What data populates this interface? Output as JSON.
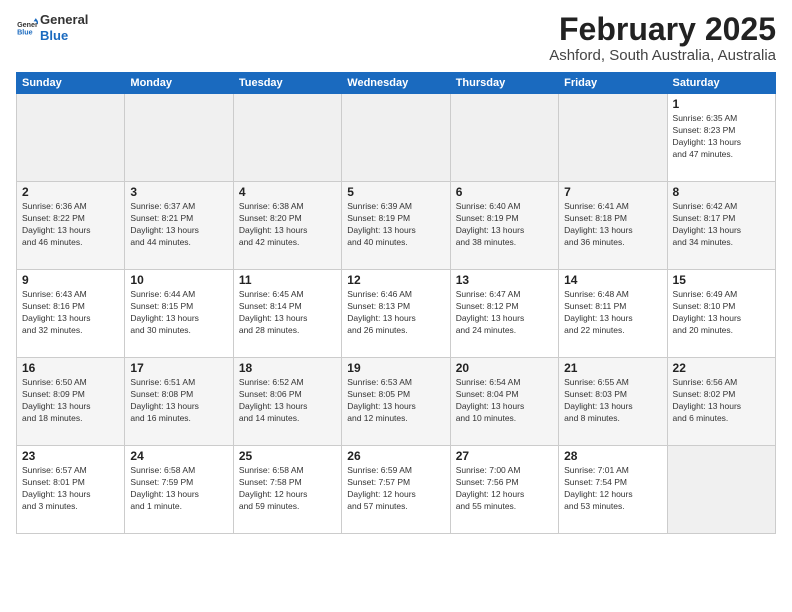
{
  "logo": {
    "line1": "General",
    "line2": "Blue"
  },
  "title": "February 2025",
  "subtitle": "Ashford, South Australia, Australia",
  "headers": [
    "Sunday",
    "Monday",
    "Tuesday",
    "Wednesday",
    "Thursday",
    "Friday",
    "Saturday"
  ],
  "weeks": [
    [
      {
        "day": "",
        "info": ""
      },
      {
        "day": "",
        "info": ""
      },
      {
        "day": "",
        "info": ""
      },
      {
        "day": "",
        "info": ""
      },
      {
        "day": "",
        "info": ""
      },
      {
        "day": "",
        "info": ""
      },
      {
        "day": "1",
        "info": "Sunrise: 6:35 AM\nSunset: 8:23 PM\nDaylight: 13 hours\nand 47 minutes."
      }
    ],
    [
      {
        "day": "2",
        "info": "Sunrise: 6:36 AM\nSunset: 8:22 PM\nDaylight: 13 hours\nand 46 minutes."
      },
      {
        "day": "3",
        "info": "Sunrise: 6:37 AM\nSunset: 8:21 PM\nDaylight: 13 hours\nand 44 minutes."
      },
      {
        "day": "4",
        "info": "Sunrise: 6:38 AM\nSunset: 8:20 PM\nDaylight: 13 hours\nand 42 minutes."
      },
      {
        "day": "5",
        "info": "Sunrise: 6:39 AM\nSunset: 8:19 PM\nDaylight: 13 hours\nand 40 minutes."
      },
      {
        "day": "6",
        "info": "Sunrise: 6:40 AM\nSunset: 8:19 PM\nDaylight: 13 hours\nand 38 minutes."
      },
      {
        "day": "7",
        "info": "Sunrise: 6:41 AM\nSunset: 8:18 PM\nDaylight: 13 hours\nand 36 minutes."
      },
      {
        "day": "8",
        "info": "Sunrise: 6:42 AM\nSunset: 8:17 PM\nDaylight: 13 hours\nand 34 minutes."
      }
    ],
    [
      {
        "day": "9",
        "info": "Sunrise: 6:43 AM\nSunset: 8:16 PM\nDaylight: 13 hours\nand 32 minutes."
      },
      {
        "day": "10",
        "info": "Sunrise: 6:44 AM\nSunset: 8:15 PM\nDaylight: 13 hours\nand 30 minutes."
      },
      {
        "day": "11",
        "info": "Sunrise: 6:45 AM\nSunset: 8:14 PM\nDaylight: 13 hours\nand 28 minutes."
      },
      {
        "day": "12",
        "info": "Sunrise: 6:46 AM\nSunset: 8:13 PM\nDaylight: 13 hours\nand 26 minutes."
      },
      {
        "day": "13",
        "info": "Sunrise: 6:47 AM\nSunset: 8:12 PM\nDaylight: 13 hours\nand 24 minutes."
      },
      {
        "day": "14",
        "info": "Sunrise: 6:48 AM\nSunset: 8:11 PM\nDaylight: 13 hours\nand 22 minutes."
      },
      {
        "day": "15",
        "info": "Sunrise: 6:49 AM\nSunset: 8:10 PM\nDaylight: 13 hours\nand 20 minutes."
      }
    ],
    [
      {
        "day": "16",
        "info": "Sunrise: 6:50 AM\nSunset: 8:09 PM\nDaylight: 13 hours\nand 18 minutes."
      },
      {
        "day": "17",
        "info": "Sunrise: 6:51 AM\nSunset: 8:08 PM\nDaylight: 13 hours\nand 16 minutes."
      },
      {
        "day": "18",
        "info": "Sunrise: 6:52 AM\nSunset: 8:06 PM\nDaylight: 13 hours\nand 14 minutes."
      },
      {
        "day": "19",
        "info": "Sunrise: 6:53 AM\nSunset: 8:05 PM\nDaylight: 13 hours\nand 12 minutes."
      },
      {
        "day": "20",
        "info": "Sunrise: 6:54 AM\nSunset: 8:04 PM\nDaylight: 13 hours\nand 10 minutes."
      },
      {
        "day": "21",
        "info": "Sunrise: 6:55 AM\nSunset: 8:03 PM\nDaylight: 13 hours\nand 8 minutes."
      },
      {
        "day": "22",
        "info": "Sunrise: 6:56 AM\nSunset: 8:02 PM\nDaylight: 13 hours\nand 6 minutes."
      }
    ],
    [
      {
        "day": "23",
        "info": "Sunrise: 6:57 AM\nSunset: 8:01 PM\nDaylight: 13 hours\nand 3 minutes."
      },
      {
        "day": "24",
        "info": "Sunrise: 6:58 AM\nSunset: 7:59 PM\nDaylight: 13 hours\nand 1 minute."
      },
      {
        "day": "25",
        "info": "Sunrise: 6:58 AM\nSunset: 7:58 PM\nDaylight: 12 hours\nand 59 minutes."
      },
      {
        "day": "26",
        "info": "Sunrise: 6:59 AM\nSunset: 7:57 PM\nDaylight: 12 hours\nand 57 minutes."
      },
      {
        "day": "27",
        "info": "Sunrise: 7:00 AM\nSunset: 7:56 PM\nDaylight: 12 hours\nand 55 minutes."
      },
      {
        "day": "28",
        "info": "Sunrise: 7:01 AM\nSunset: 7:54 PM\nDaylight: 12 hours\nand 53 minutes."
      },
      {
        "day": "",
        "info": ""
      }
    ]
  ]
}
